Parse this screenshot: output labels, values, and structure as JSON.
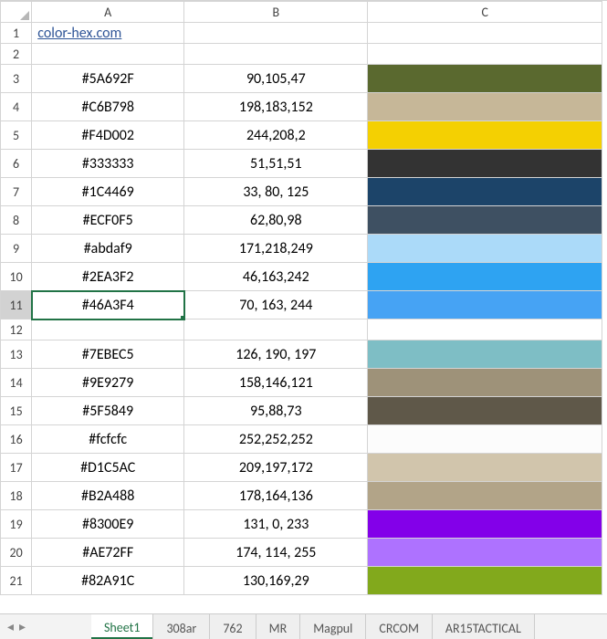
{
  "columns": [
    "A",
    "B",
    "C"
  ],
  "link": {
    "text": "color-hex.com"
  },
  "selected_cell": {
    "row": 11,
    "col": "A"
  },
  "rows": [
    {
      "n": 1,
      "a": "color-hex.com",
      "b": "",
      "c": null,
      "is_link": true
    },
    {
      "n": 2,
      "a": "",
      "b": "",
      "c": null
    },
    {
      "n": 3,
      "a": "#5A692F",
      "b": "90,105,47",
      "c": "#5A692F"
    },
    {
      "n": 4,
      "a": "#C6B798",
      "b": "198,183,152",
      "c": "#C6B798"
    },
    {
      "n": 5,
      "a": "#F4D002",
      "b": "244,208,2",
      "c": "#F4D002"
    },
    {
      "n": 6,
      "a": "#333333",
      "b": "51,51,51",
      "c": "#333333"
    },
    {
      "n": 7,
      "a": "#1C4469",
      "b": "33, 80, 125",
      "c": "#1C4469"
    },
    {
      "n": 8,
      "a": "#ECF0F5",
      "b": "62,80,98",
      "c": "#3E5062"
    },
    {
      "n": 9,
      "a": "#abdaf9",
      "b": "171,218,249",
      "c": "#abdaf9"
    },
    {
      "n": 10,
      "a": "#2EA3F2",
      "b": "46,163,242",
      "c": "#2EA3F2"
    },
    {
      "n": 11,
      "a": "#46A3F4",
      "b": "70, 163, 244",
      "c": "#46A3F4"
    },
    {
      "n": 12,
      "a": "",
      "b": "",
      "c": null
    },
    {
      "n": 13,
      "a": "#7EBEC5",
      "b": "126, 190, 197",
      "c": "#7EBEC5"
    },
    {
      "n": 14,
      "a": "#9E9279",
      "b": "158,146,121",
      "c": "#9E9279"
    },
    {
      "n": 15,
      "a": "#5F5849",
      "b": "95,88,73",
      "c": "#5F5849"
    },
    {
      "n": 16,
      "a": "#fcfcfc",
      "b": "252,252,252",
      "c": "#fcfcfc"
    },
    {
      "n": 17,
      "a": "#D1C5AC",
      "b": "209,197,172",
      "c": "#D1C5AC"
    },
    {
      "n": 18,
      "a": "#B2A488",
      "b": "178,164,136",
      "c": "#B2A488"
    },
    {
      "n": 19,
      "a": "#8300E9",
      "b": "131, 0, 233",
      "c": "#8300E9"
    },
    {
      "n": 20,
      "a": "#AE72FF",
      "b": "174, 114, 255",
      "c": "#AE72FF"
    },
    {
      "n": 21,
      "a": "#82A91C",
      "b": "130,169,29",
      "c": "#82A91C"
    }
  ],
  "tabs": [
    {
      "label": "Sheet1",
      "active": true
    },
    {
      "label": "308ar",
      "active": false
    },
    {
      "label": "762",
      "active": false
    },
    {
      "label": "MR",
      "active": false
    },
    {
      "label": "Magpul",
      "active": false
    },
    {
      "label": "CRCOM",
      "active": false
    },
    {
      "label": "AR15TACTICAL",
      "active": false
    }
  ],
  "nav": {
    "prev_glyph": "◂",
    "next_glyph": "▸"
  }
}
